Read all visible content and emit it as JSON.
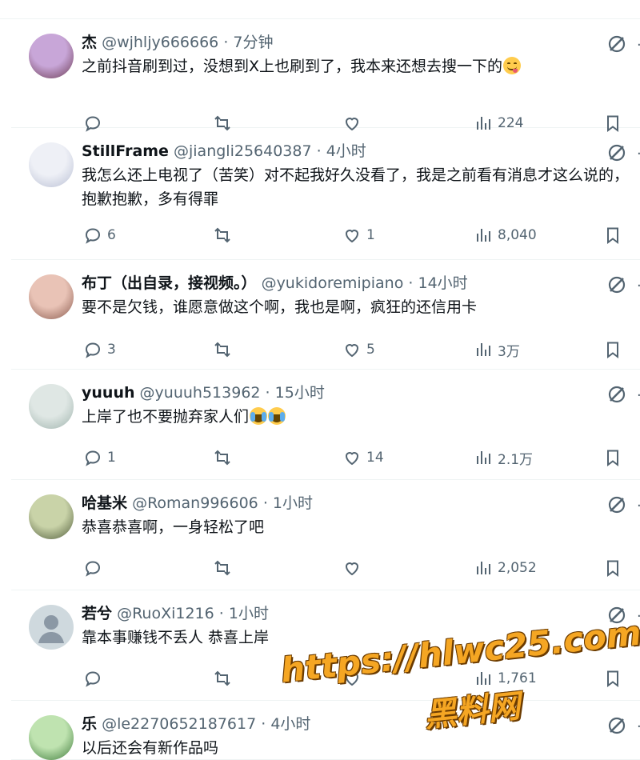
{
  "replies": [
    {
      "name": "杰",
      "handle": "@wjhljy666666",
      "dot": "·",
      "time": "7分钟",
      "text": "之前抖音刷到过，没想到X上也刷到了，我本来还想去搜一下的",
      "emoji": "yum",
      "reply_count": "",
      "like_count": "",
      "views": "224",
      "avatar_colors": [
        "#c8a6d8",
        "#6b3a52"
      ]
    },
    {
      "name": "StillFrame",
      "handle": "@jiangli25640387",
      "dot": "·",
      "time": "4小时",
      "text": "我怎么还上电视了（苦笑）对不起我好久没看了，我是之前看有消息才这么说的，抱歉抱歉，多有得罪",
      "emoji": "",
      "reply_count": "6",
      "like_count": "1",
      "views": "8,040",
      "avatar_colors": [
        "#eef0f6",
        "#b9bfd4"
      ]
    },
    {
      "name": "布丁（出自录，接视频。）",
      "handle": "@yukidoremipiano",
      "dot": "·",
      "time": "14小时",
      "text": "要不是欠钱，谁愿意做这个啊，我也是啊，疯狂的还信用卡",
      "emoji": "",
      "reply_count": "3",
      "like_count": "5",
      "views": "3万",
      "avatar_colors": [
        "#e9c3b6",
        "#8a5a4e"
      ]
    },
    {
      "name": "yuuuh",
      "handle": "@yuuuh513962",
      "dot": "·",
      "time": "15小时",
      "text": "上岸了也不要抛弃家人们",
      "emoji": "cry2",
      "reply_count": "1",
      "like_count": "14",
      "views": "2.1万",
      "avatar_colors": [
        "#dfe7e4",
        "#9fb3ad"
      ]
    },
    {
      "name": "哈基米",
      "handle": "@Roman996606",
      "dot": "·",
      "time": "1小时",
      "text": "恭喜恭喜啊，一身轻松了吧",
      "emoji": "",
      "reply_count": "",
      "like_count": "",
      "views": "2,052",
      "avatar_colors": [
        "#c9d3a8",
        "#4f5b3a"
      ]
    },
    {
      "name": "若兮",
      "handle": "@RuoXi1216",
      "dot": "·",
      "time": "1小时",
      "text": "靠本事赚钱不丢人 恭喜上岸",
      "emoji": "",
      "reply_count": "",
      "like_count": "",
      "views": "1,761",
      "avatar_colors": [
        "#cfd9de",
        "#8b98a5"
      ]
    },
    {
      "name": "乐",
      "handle": "@le2270652187617",
      "dot": "·",
      "time": "4小时",
      "text": "以后还会有新作品吗",
      "emoji": "",
      "reply_count": "",
      "like_count": "",
      "views": "",
      "avatar_colors": [
        "#bfe3b0",
        "#3d7a3a"
      ]
    }
  ],
  "watermark": {
    "url": "https://hlwc25.com",
    "name": "黑料网"
  },
  "colors": {
    "text_primary": "#0f1419",
    "text_secondary": "#536471",
    "divider": "#eff3f4",
    "watermark": "#f5a623"
  },
  "icons": {
    "reply": "reply-icon",
    "retweet": "retweet-icon",
    "like": "heart-icon",
    "views": "bar-chart-icon",
    "bookmark": "bookmark-icon",
    "grok": "grok-icon"
  }
}
